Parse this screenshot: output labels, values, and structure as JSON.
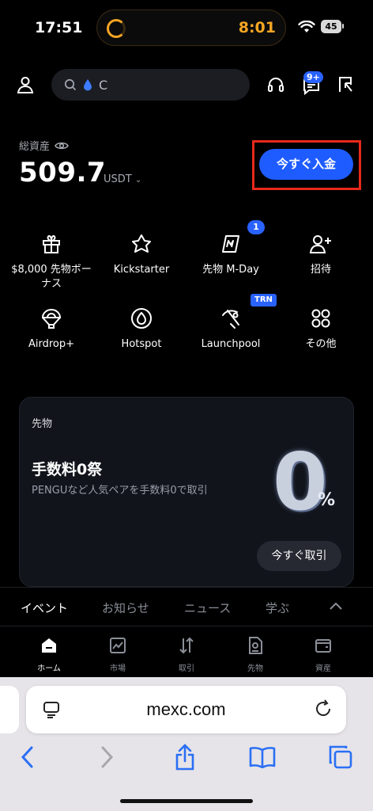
{
  "status_bar": {
    "time": "17:51",
    "island_time": "8:01",
    "battery": "45"
  },
  "header": {
    "search_placeholder": "C",
    "notif_badge": "9+"
  },
  "assets": {
    "label": "総資産",
    "value": "509.7",
    "unit": "USDT",
    "deposit_button": "今すぐ入金"
  },
  "shortcuts": [
    {
      "label": "$8,000 先物ボーナス",
      "icon": "gift-icon"
    },
    {
      "label": "Kickstarter",
      "icon": "rocket-icon"
    },
    {
      "label": "先物 M-Day",
      "icon": "mday-icon",
      "badge": "1"
    },
    {
      "label": "招待",
      "icon": "invite-user-icon"
    },
    {
      "label": "Airdrop+",
      "icon": "parachute-icon"
    },
    {
      "label": "Hotspot",
      "icon": "flame-icon"
    },
    {
      "label": "Launchpool",
      "icon": "pickaxe-icon",
      "badge": "TRN"
    },
    {
      "label": "その他",
      "icon": "more-grid-icon"
    }
  ],
  "promo": {
    "tag": "先物",
    "title": "手数料0祭",
    "description": "PENGUなど人気ペアを手数料0で取引",
    "graphic_zero": "0",
    "graphic_pct": "%",
    "button": "今すぐ取引"
  },
  "news_tabs": [
    "イベント",
    "お知らせ",
    "ニュース",
    "学ぶ"
  ],
  "bottom_nav": [
    {
      "label": "ホーム",
      "icon": "home-icon"
    },
    {
      "label": "市場",
      "icon": "chart-icon"
    },
    {
      "label": "取引",
      "icon": "trade-arrows-icon"
    },
    {
      "label": "先物",
      "icon": "futures-doc-icon"
    },
    {
      "label": "資産",
      "icon": "wallet-icon"
    }
  ],
  "browser": {
    "url": "mexc.com"
  },
  "colors": {
    "accent": "#1f5cff",
    "highlight": "#e8291b",
    "background": "#000000"
  }
}
